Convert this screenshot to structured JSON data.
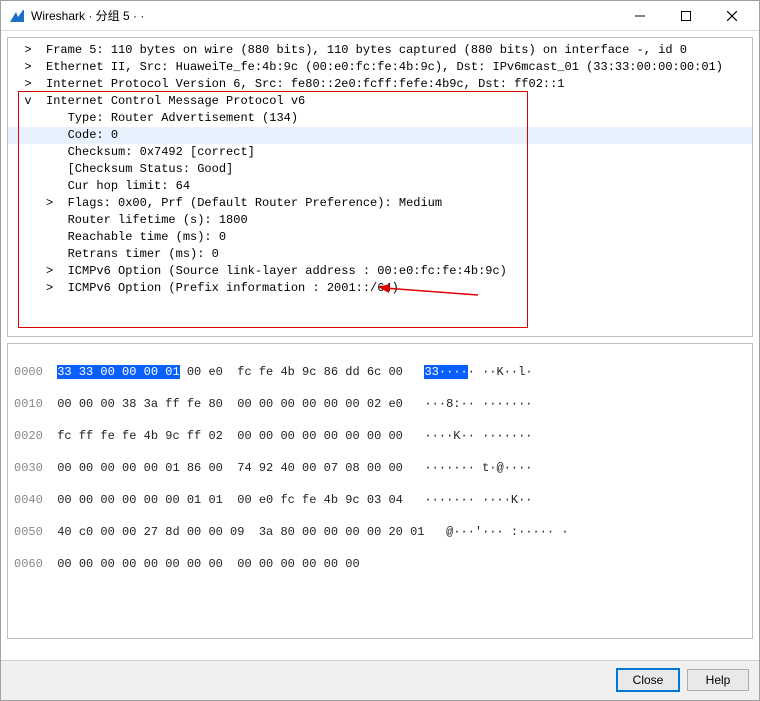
{
  "window": {
    "title": "Wireshark · 分组 5 · ·"
  },
  "tree": {
    "l0": "Frame 5: 110 bytes on wire (880 bits), 110 bytes captured (880 bits) on interface -, id 0",
    "l1": "Ethernet II, Src: HuaweiTe_fe:4b:9c (00:e0:fc:fe:4b:9c), Dst: IPv6mcast_01 (33:33:00:00:00:01)",
    "l2": "Internet Protocol Version 6, Src: fe80::2e0:fcff:fefe:4b9c, Dst: ff02::1",
    "l3": "Internet Control Message Protocol v6",
    "l4": "Type: Router Advertisement (134)",
    "l5": "Code: 0",
    "l6": "Checksum: 0x7492 [correct]",
    "l7": "[Checksum Status: Good]",
    "l8": "Cur hop limit: 64",
    "l9": "Flags: 0x00, Prf (Default Router Preference): Medium",
    "l10": "Router lifetime (s): 1800",
    "l11": "Reachable time (ms): 0",
    "l12": "Retrans timer (ms): 0",
    "l13": "ICMPv6 Option (Source link-layer address : 00:e0:fc:fe:4b:9c)",
    "l14": "ICMPv6 Option (Prefix information : 2001::/64)"
  },
  "hex": {
    "r0": {
      "off": "0000",
      "b": "33 33 00 00 00 01 00 e0  fc fe 4b 9c 86 dd 6c 00",
      "a": "33····· ··K··l·",
      "selLen": 6
    },
    "r1": {
      "off": "0010",
      "b": "00 00 00 38 3a ff fe 80  00 00 00 00 00 00 02 e0",
      "a": "···8:·· ·······"
    },
    "r2": {
      "off": "0020",
      "b": "fc ff fe fe 4b 9c ff 02  00 00 00 00 00 00 00 00",
      "a": "····K·· ·······"
    },
    "r3": {
      "off": "0030",
      "b": "00 00 00 00 00 01 86 00  74 92 40 00 07 08 00 00",
      "a": "······· t·@····"
    },
    "r4": {
      "off": "0040",
      "b": "00 00 00 00 00 00 01 01  00 e0 fc fe 4b 9c 03 04",
      "a": "······· ····K··"
    },
    "r5": {
      "off": "0050",
      "b": "40 c0 00 00 27 8d 00 00 09  3a 80 00 00 00 00 20 01",
      "a": "@···'··· :····· ·"
    },
    "r6": {
      "off": "0060",
      "b": "00 00 00 00 00 00 00 00  00 00 00 00 00 00",
      "a": ""
    }
  },
  "footer": {
    "close": "Close",
    "help": "Help"
  }
}
